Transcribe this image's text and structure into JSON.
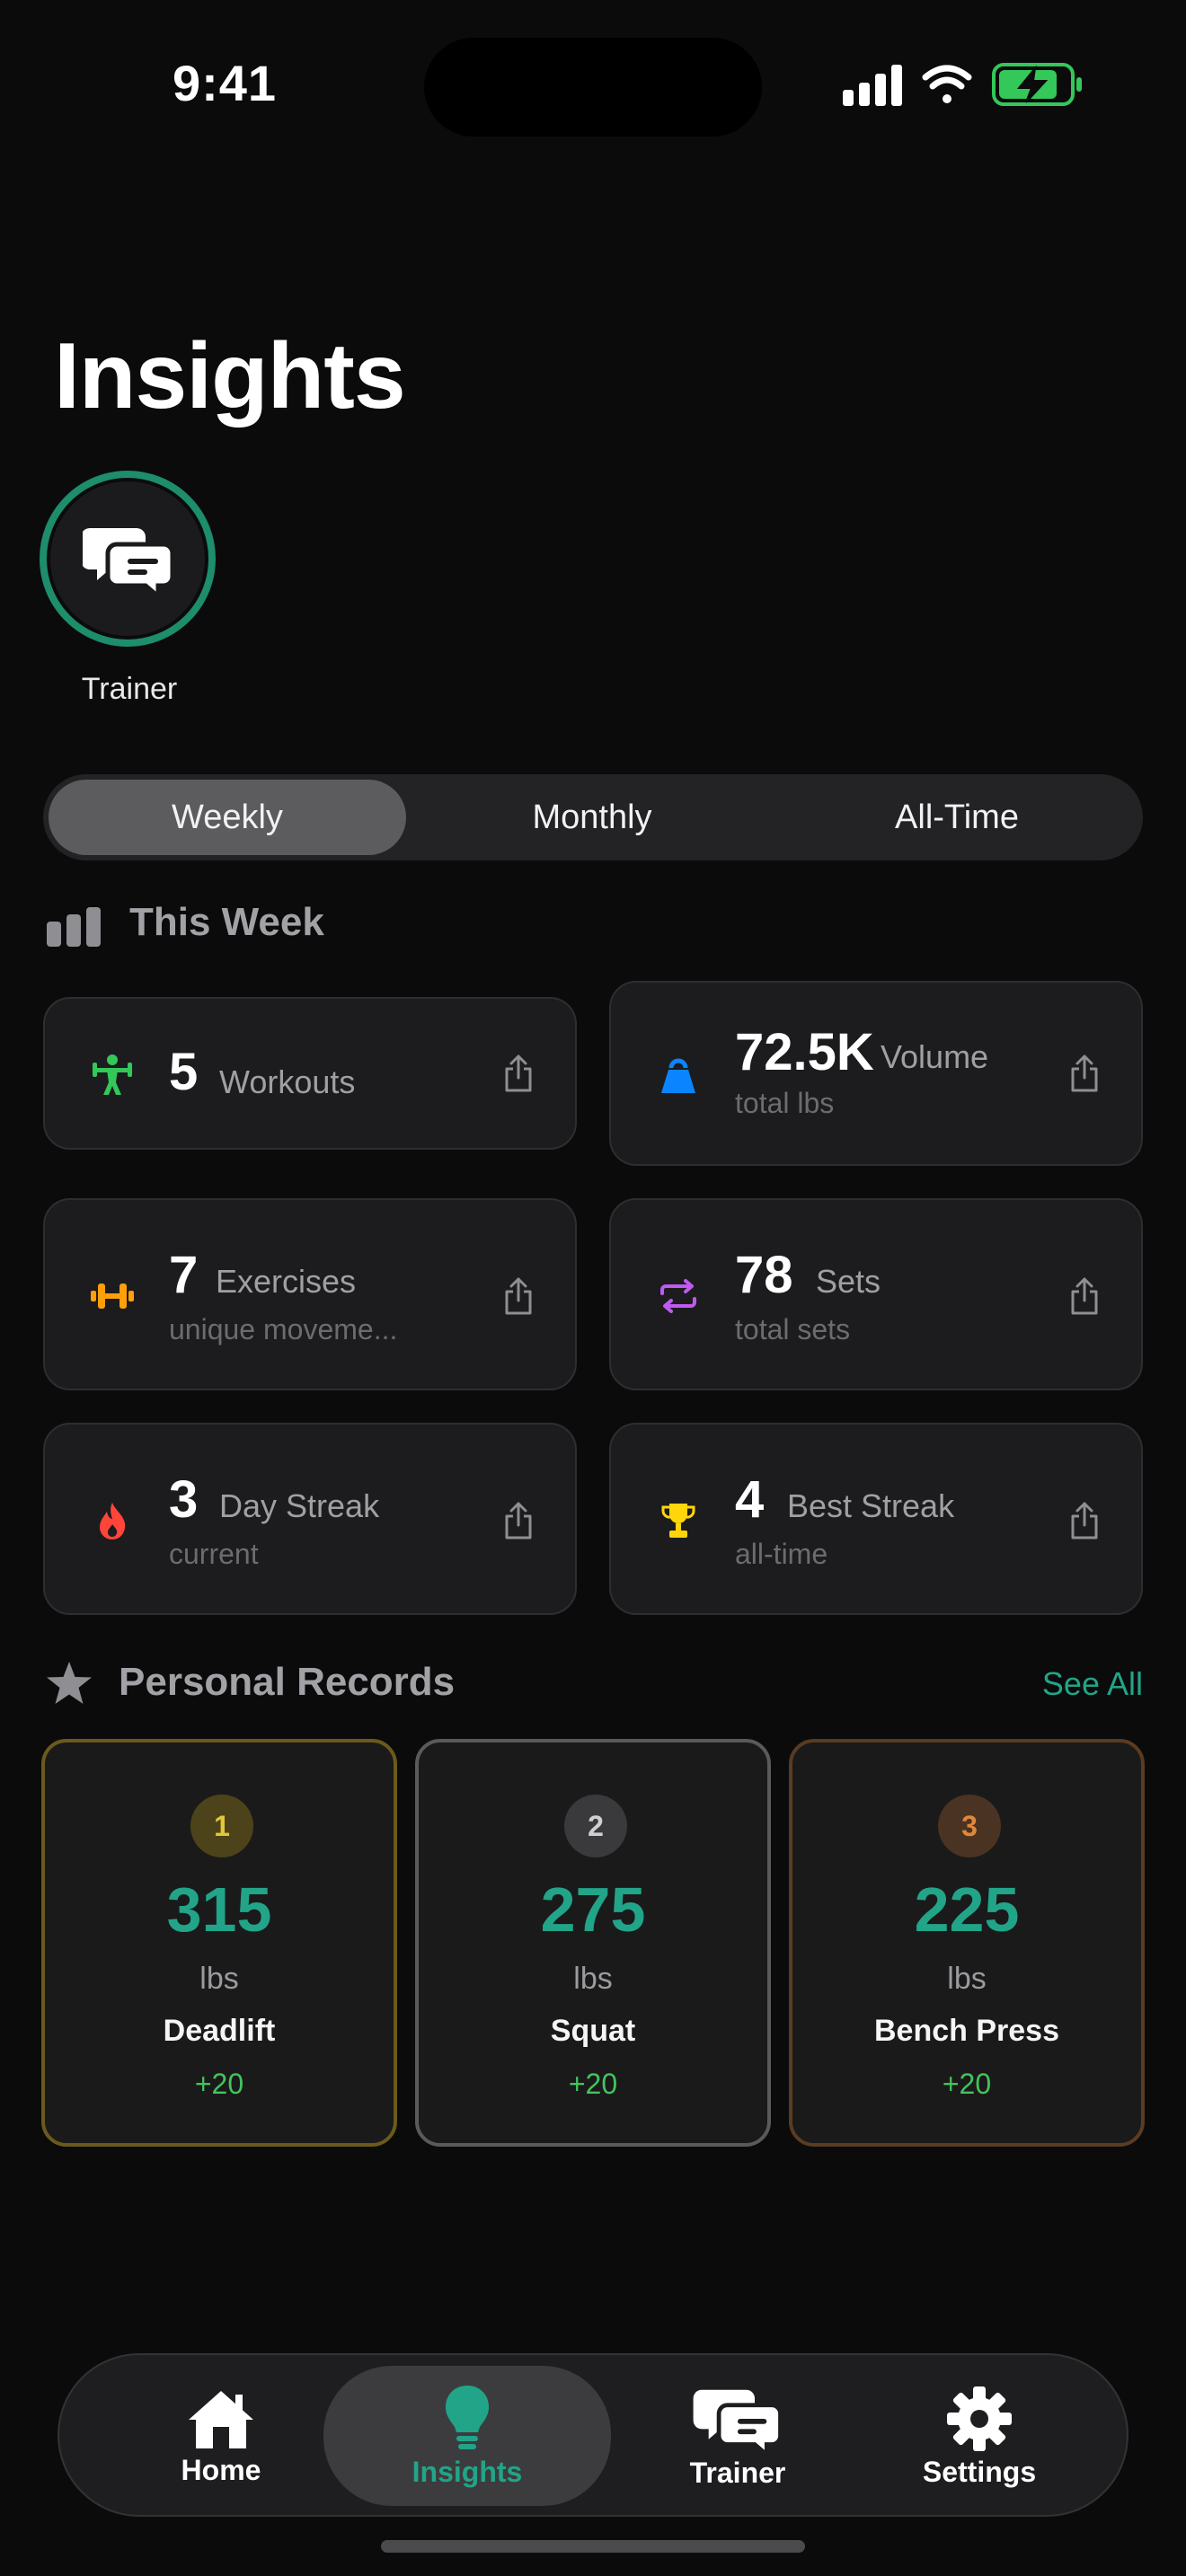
{
  "status_bar": {
    "time": "9:41"
  },
  "header": {
    "title": "Insights"
  },
  "trainer_story": {
    "label": "Trainer"
  },
  "segments": [
    {
      "label": "Weekly",
      "active": true
    },
    {
      "label": "Monthly",
      "active": false
    },
    {
      "label": "All-Time",
      "active": false
    }
  ],
  "this_week": {
    "title": "This Week",
    "cards": [
      {
        "icon": "figure-strength-icon",
        "color": "#34c759",
        "value": "5",
        "label": "Workouts",
        "sub": ""
      },
      {
        "icon": "kettlebell-icon",
        "color": "#0a84ff",
        "value": "72.5K",
        "label": "Volume",
        "sub": "total lbs"
      },
      {
        "icon": "dumbbell-icon",
        "color": "#ff9f0a",
        "value": "7",
        "label": "Exercises",
        "sub": "unique moveme..."
      },
      {
        "icon": "repeat-arrows-icon",
        "color": "#bf5af2",
        "value": "78",
        "label": "Sets",
        "sub": "total sets"
      },
      {
        "icon": "flame-icon",
        "color": "#ff453a",
        "value": "3",
        "label": "Day Streak",
        "sub": "current"
      },
      {
        "icon": "trophy-icon",
        "color": "#ffd60a",
        "value": "4",
        "label": "Best Streak",
        "sub": "all-time"
      }
    ]
  },
  "personal_records": {
    "title": "Personal Records",
    "see_all": "See All",
    "items": [
      {
        "rank": "1",
        "value": "315",
        "unit": "lbs",
        "exercise": "Deadlift",
        "delta": "+20"
      },
      {
        "rank": "2",
        "value": "275",
        "unit": "lbs",
        "exercise": "Squat",
        "delta": "+20"
      },
      {
        "rank": "3",
        "value": "225",
        "unit": "lbs",
        "exercise": "Bench Press",
        "delta": "+20"
      }
    ]
  },
  "tabbar": {
    "items": [
      {
        "label": "Home",
        "icon": "house-icon"
      },
      {
        "label": "Insights",
        "icon": "lightbulb-icon",
        "active": true
      },
      {
        "label": "Trainer",
        "icon": "chat-bubbles-icon"
      },
      {
        "label": "Settings",
        "icon": "gear-icon"
      }
    ]
  },
  "colors": {
    "accent": "#22a488",
    "positive": "#43c35c",
    "gold": "#6b5a1c",
    "silver": "#5a5a5c",
    "bronze": "#5a3c22"
  }
}
